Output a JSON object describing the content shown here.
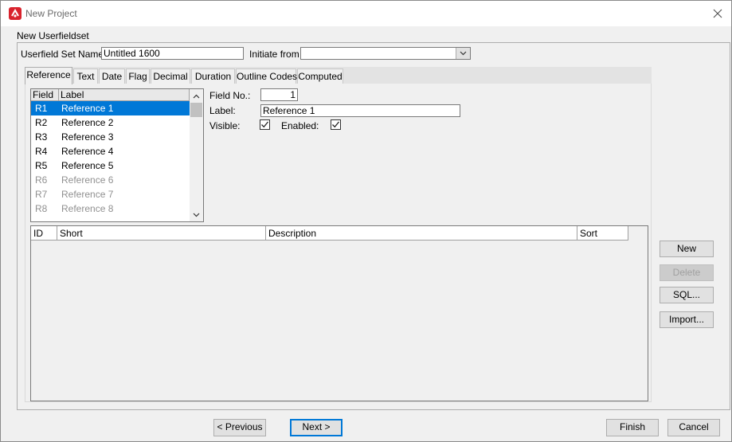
{
  "window": {
    "title": "New Project"
  },
  "group": {
    "label": "New Userfieldset"
  },
  "form": {
    "set_name_label": "Userfield Set Name :",
    "set_name_value": "Untitled 1600",
    "initiate_label": "Initiate from :",
    "initiate_value": ""
  },
  "tabs": [
    {
      "label": "Reference",
      "active": true
    },
    {
      "label": "Text"
    },
    {
      "label": "Date"
    },
    {
      "label": "Flag"
    },
    {
      "label": "Decimal"
    },
    {
      "label": "Duration"
    },
    {
      "label": "Outline Codes"
    },
    {
      "label": "Computed"
    }
  ],
  "fields_list": {
    "columns": [
      "Field",
      "Label"
    ],
    "rows": [
      {
        "field": "R1",
        "label": "Reference 1",
        "selected": true
      },
      {
        "field": "R2",
        "label": "Reference 2"
      },
      {
        "field": "R3",
        "label": "Reference 3"
      },
      {
        "field": "R4",
        "label": "Reference 4"
      },
      {
        "field": "R5",
        "label": "Reference 5"
      },
      {
        "field": "R6",
        "label": "Reference 6",
        "disabled": true
      },
      {
        "field": "R7",
        "label": "Reference 7",
        "disabled": true
      },
      {
        "field": "R8",
        "label": "Reference 8",
        "disabled": true
      }
    ]
  },
  "detail": {
    "field_no_label": "Field No.:",
    "field_no_value": "1",
    "label_label": "Label:",
    "label_value": "Reference 1",
    "visible_label": "Visible:",
    "visible_checked": true,
    "enabled_label": "Enabled:",
    "enabled_checked": true
  },
  "codes_grid": {
    "columns": [
      "ID",
      "Short",
      "Description",
      "Sort"
    ]
  },
  "side_buttons": {
    "new": "New",
    "delete": "Delete",
    "sql": "SQL...",
    "import": "Import..."
  },
  "footer": {
    "previous": "< Previous",
    "next": "Next >",
    "finish": "Finish",
    "cancel": "Cancel"
  },
  "colors": {
    "selection": "#0078d7",
    "app_icon": "#d9232d"
  },
  "icons": {
    "app": "app-logo-icon",
    "close": "close-icon",
    "combo": "chevron-down-icon",
    "scroll_up": "chevron-up-icon",
    "scroll_down": "chevron-down-icon",
    "check": "checkmark-icon"
  }
}
